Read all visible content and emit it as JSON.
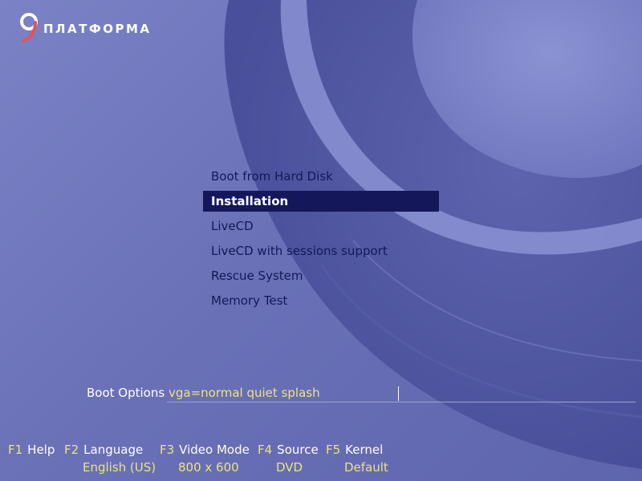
{
  "logo": {
    "glyph": "9",
    "text": "ПЛАТФОРМА"
  },
  "boot_menu": {
    "items": [
      {
        "label": "Boot from Hard Disk",
        "selected": false
      },
      {
        "label": "Installation",
        "selected": true
      },
      {
        "label": "LiveCD",
        "selected": false
      },
      {
        "label": "LiveCD with sessions support",
        "selected": false
      },
      {
        "label": "Rescue System",
        "selected": false
      },
      {
        "label": "Memory Test",
        "selected": false
      }
    ]
  },
  "boot_options": {
    "label": "Boot Options",
    "value": "vga=normal quiet splash"
  },
  "function_keys": [
    {
      "key": "F1",
      "label": "Help",
      "value": ""
    },
    {
      "key": "F2",
      "label": "Language",
      "value": "English (US)"
    },
    {
      "key": "F3",
      "label": "Video Mode",
      "value": "800 x 600"
    },
    {
      "key": "F4",
      "label": "Source",
      "value": "DVD"
    },
    {
      "key": "F5",
      "label": "Kernel",
      "value": "Default"
    }
  ],
  "colors": {
    "background": "#6d73b8",
    "menu_text": "#14185a",
    "selection_bg": "#14185a",
    "accent_yellow": "#f0e27a",
    "logo_accent": "#e8505b"
  }
}
